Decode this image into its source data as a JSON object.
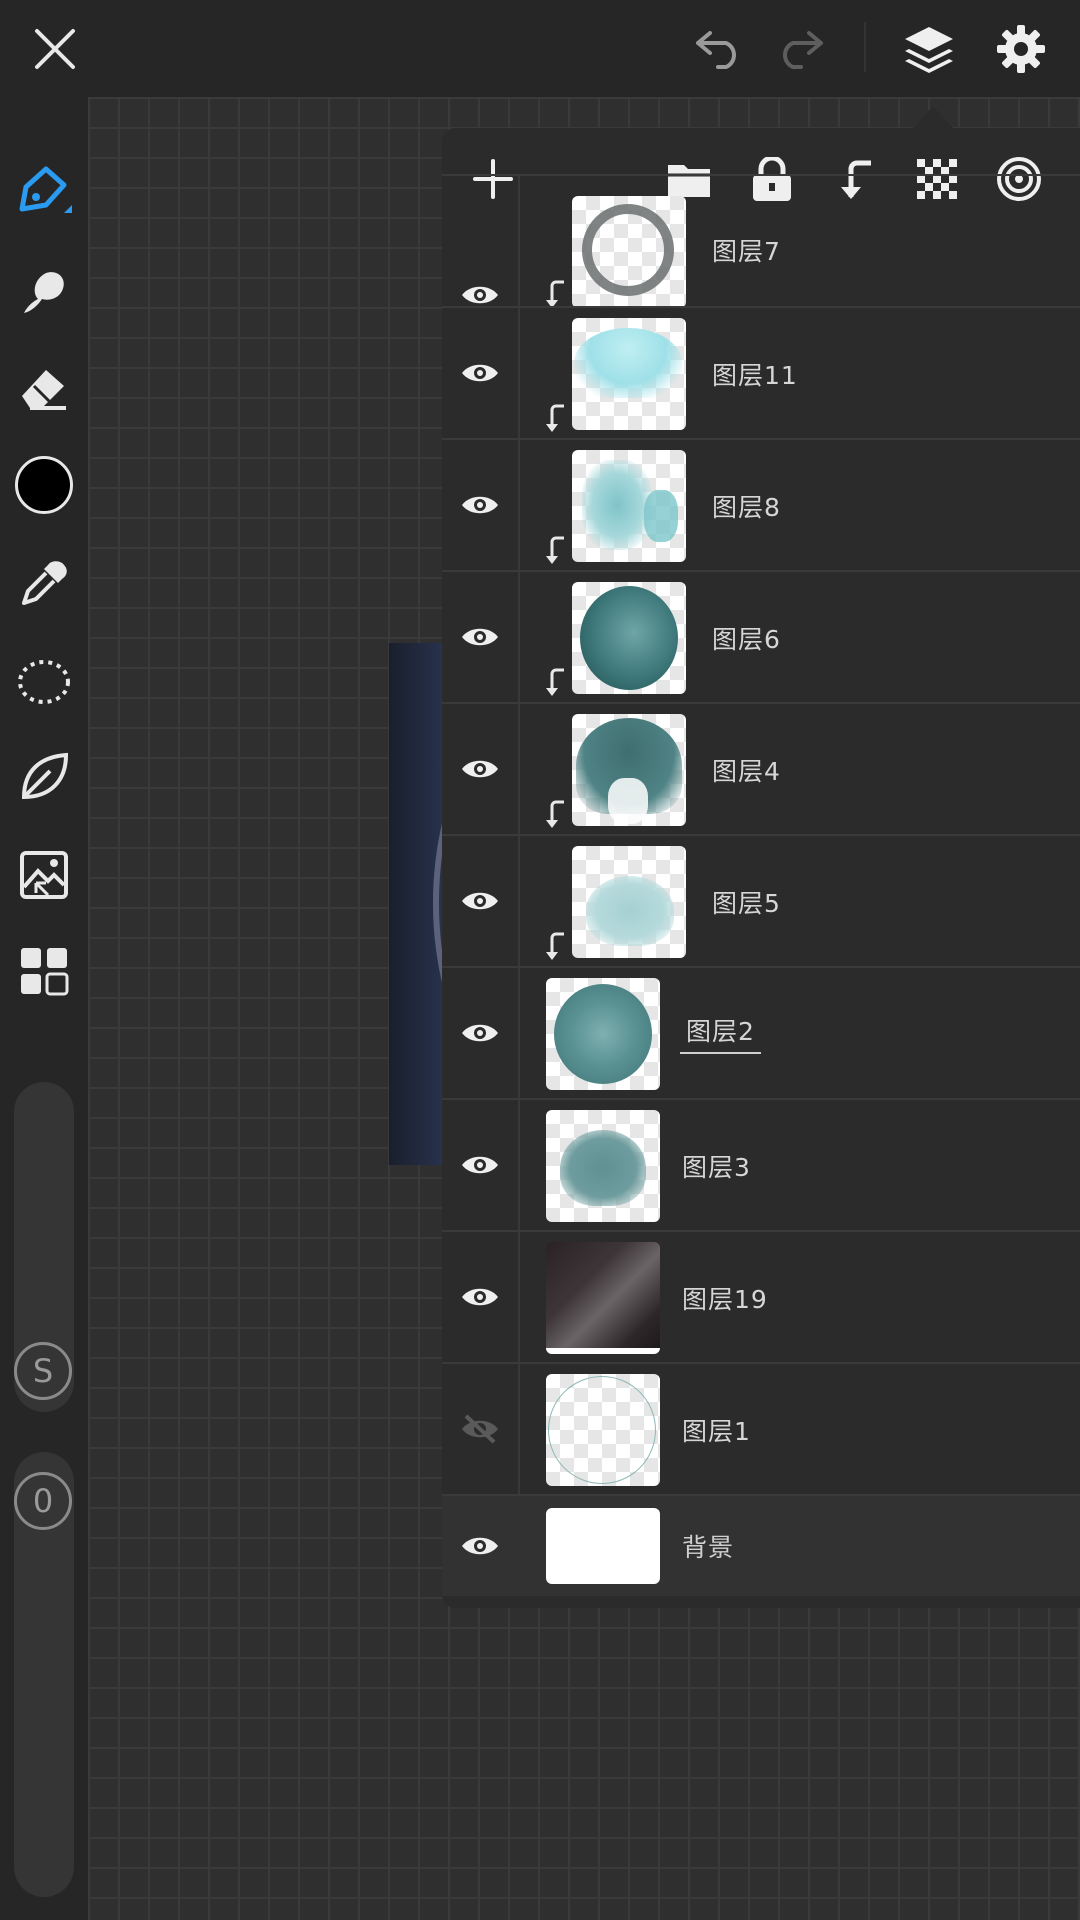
{
  "app": {
    "toolbar": {
      "close": "close-icon",
      "undo": "undo-icon",
      "redo": "redo-icon",
      "layers": "layers-icon",
      "settings": "gear-icon"
    },
    "tools": [
      "brush-icon",
      "smudge-icon",
      "eraser-icon",
      "color-swatch",
      "eyedropper-icon",
      "lasso-icon",
      "leaf-icon",
      "image-import-icon",
      "grid-icon"
    ],
    "current_color": "#000000",
    "size_button": "S",
    "opacity_button": "0",
    "accent": "#2a9bf0"
  },
  "layers_panel": {
    "header_icons": [
      "add-icon",
      "folder-icon",
      "lock-icon",
      "clip-icon",
      "alpha-lock-icon",
      "target-icon"
    ],
    "layers": [
      {
        "name": "图层7",
        "visible": true,
        "clipped": true
      },
      {
        "name": "图层11",
        "visible": true,
        "clipped": true
      },
      {
        "name": "图层8",
        "visible": true,
        "clipped": true
      },
      {
        "name": "图层6",
        "visible": true,
        "clipped": true
      },
      {
        "name": "图层4",
        "visible": true,
        "clipped": true
      },
      {
        "name": "图层5",
        "visible": true,
        "clipped": true
      },
      {
        "name": "图层2",
        "visible": true,
        "clipped": false,
        "active": true
      },
      {
        "name": "图层3",
        "visible": true,
        "clipped": false
      },
      {
        "name": "图层19",
        "visible": true,
        "clipped": false
      },
      {
        "name": "图层1",
        "visible": false,
        "clipped": false
      },
      {
        "name": "背景",
        "visible": true,
        "clipped": false,
        "background": true
      }
    ]
  }
}
